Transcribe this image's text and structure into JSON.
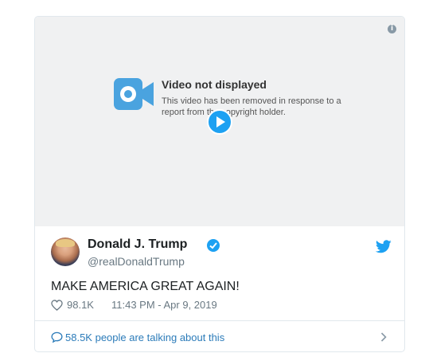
{
  "media": {
    "title": "Video not displayed",
    "description": "This video has been removed in response to a report from the copyright holder.",
    "info_icon": "i",
    "camera_icon": "video-camera-icon",
    "accent": "#1da1f2"
  },
  "tweet": {
    "name": "Donald J. Trump",
    "handle": "@realDonaldTrump",
    "text": "MAKE AMERICA GREAT AGAIN!",
    "likes": "98.1K",
    "timestamp": "11:43 PM - Apr 9, 2019",
    "talking": "58.5K people are talking about this"
  },
  "colors": {
    "twitter_blue": "#1da1f2",
    "link_blue": "#2b7bb9",
    "muted_gray": "#697882"
  }
}
